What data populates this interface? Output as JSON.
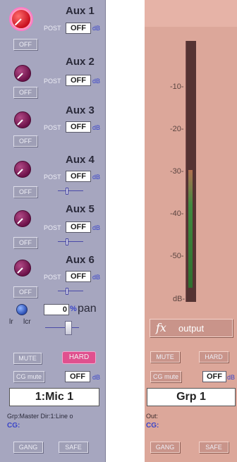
{
  "left_strip": {
    "aux_sends": [
      {
        "label": "Aux 1",
        "mode": "POST",
        "value": "OFF",
        "unit": "dB",
        "off_label": "OFF"
      },
      {
        "label": "Aux 2",
        "mode": "POST",
        "value": "OFF",
        "unit": "dB",
        "off_label": "OFF"
      },
      {
        "label": "Aux 3",
        "mode": "POST",
        "value": "OFF",
        "unit": "dB",
        "off_label": "OFF"
      },
      {
        "label": "Aux 4",
        "mode": "POST",
        "value": "OFF",
        "unit": "dB",
        "off_label": "OFF"
      },
      {
        "label": "Aux 5",
        "mode": "POST",
        "value": "OFF",
        "unit": "dB",
        "off_label": "OFF"
      },
      {
        "label": "Aux 6",
        "mode": "POST",
        "value": "OFF",
        "unit": "dB",
        "off_label": "OFF"
      }
    ],
    "pan": {
      "value": "0",
      "unit": "%",
      "label": "pan",
      "left_label": "lr",
      "right_label": "lcr"
    },
    "mute_label": "MUTE",
    "hard_label": "HARD",
    "cg_mute_label": "CG mute",
    "cg_value": "OFF",
    "cg_unit": "dB",
    "channel_name": "1:Mic 1",
    "info_line": "Grp:Master  Dir:1:Line o",
    "cg_label": "CG:",
    "gang_label": "GANG",
    "safe_label": "SAFE"
  },
  "right_strip": {
    "meter_scale": [
      "-10-",
      "-20-",
      "-30-",
      "-40-",
      "-50-",
      "dB-"
    ],
    "meter_level": 0.45,
    "fx_label": "fx",
    "output_label": "output",
    "mute_label": "MUTE",
    "hard_label": "HARD",
    "cg_mute_label": "CG mute",
    "cg_value": "OFF",
    "cg_unit": "dB",
    "group_name": "Grp 1",
    "out_label": "Out:",
    "cg_label": "CG:",
    "gang_label": "GANG",
    "safe_label": "SAFE"
  },
  "colors": {
    "left_panel": "#a6a6bf",
    "right_panel": "#dca79a",
    "hard_button": "#e0508e",
    "meter_bar": "#5a3636"
  }
}
